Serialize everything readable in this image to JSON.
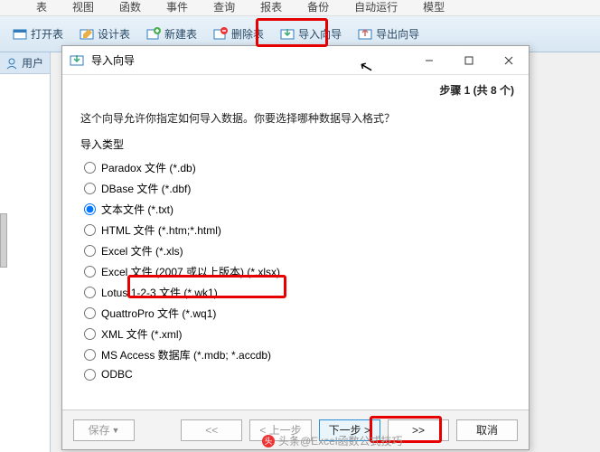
{
  "menubar": {
    "items": [
      "表",
      "视图",
      "函数",
      "事件",
      "查询",
      "报表",
      "备份",
      "自动运行",
      "模型"
    ]
  },
  "toolbar": {
    "open": "打开表",
    "design": "设计表",
    "newtable": "新建表",
    "delete": "删除表",
    "import": "导入向导",
    "export": "导出向导"
  },
  "side": {
    "user_tab": "用户"
  },
  "wizard": {
    "title": "导入向导",
    "step_label": "步骤 1 (共 8 个)",
    "prompt": "这个向导允许你指定如何导入数据。你要选择哪种数据导入格式？",
    "group_label": "导入类型",
    "radios": [
      "Paradox 文件 (*.db)",
      "DBase 文件 (*.dbf)",
      "文本文件 (*.txt)",
      "HTML 文件 (*.htm;*.html)",
      "Excel 文件 (*.xls)",
      "Excel 文件 (2007 或以上版本) (*.xlsx)",
      "Lotus 1-2-3 文件 (*.wk1)",
      "QuattroPro 文件 (*.wq1)",
      "XML 文件 (*.xml)",
      "MS Access 数据库 (*.mdb; *.accdb)",
      "ODBC"
    ],
    "selected_index": 2,
    "buttons": {
      "save": "保存",
      "back2": "<<",
      "back": "< 上一步",
      "next": "下一步 >",
      "next2": ">>",
      "cancel": "取消"
    }
  },
  "watermark": "头条@Excel函数公式技巧"
}
